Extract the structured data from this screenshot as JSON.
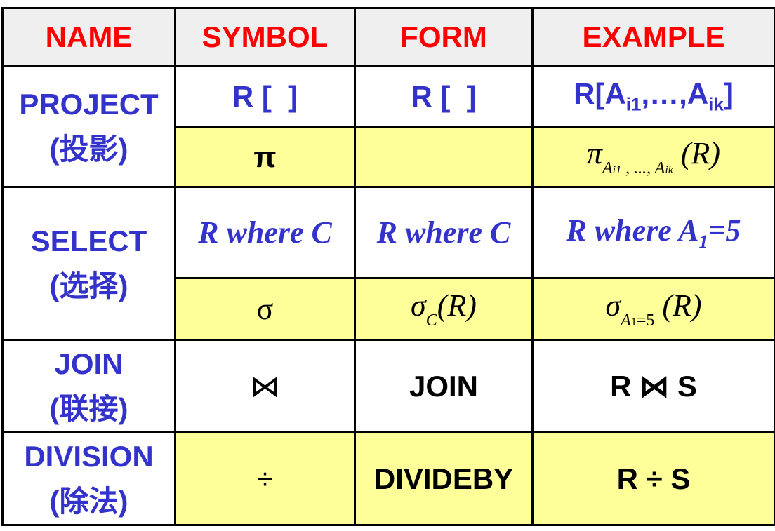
{
  "colors": {
    "header_text": "#ff0000",
    "name_text": "#3333cc",
    "highlight_bg": "#ffff99",
    "header_bg": "#efefef"
  },
  "headers": [
    "NAME",
    "SYMBOL",
    "FORM",
    "EXAMPLE"
  ],
  "rows": {
    "project": {
      "name": "PROJECT",
      "name_cn": "(投影)",
      "symbol": "R [  ]",
      "form": "R [  ]",
      "example": {
        "base": "R[A",
        "sub1": "i1",
        "mid": ",…,A",
        "sub2": "ik",
        "end": "]"
      },
      "symbol2": "π",
      "form2": "",
      "example2": {
        "op": "π",
        "sub": "A",
        "sub_i1": "i1",
        "sub_mid": " , ..., A",
        "sub_ik": "ik",
        "arg": "(R)"
      }
    },
    "select": {
      "name": "SELECT",
      "name_cn": "(选择)",
      "symbol": "R where C",
      "form": "R where C",
      "example": {
        "base": "R where A",
        "sub": "1",
        "end": "=5"
      },
      "symbol2": "σ",
      "form2": {
        "op": "σ",
        "sub": "C",
        "arg": "(R)"
      },
      "example2": {
        "op": "σ",
        "sub": "A",
        "sub_1": "1",
        "sub_end": "=5",
        "arg": "(R)"
      }
    },
    "join": {
      "name": "JOIN",
      "name_cn": "(联接)",
      "symbol": "⋈",
      "form": "JOIN",
      "example": "R ⋈ S"
    },
    "division": {
      "name": "DIVISION",
      "name_cn": "(除法)",
      "symbol": "÷",
      "form": "DIVIDEBY",
      "example": "R ÷ S"
    }
  }
}
